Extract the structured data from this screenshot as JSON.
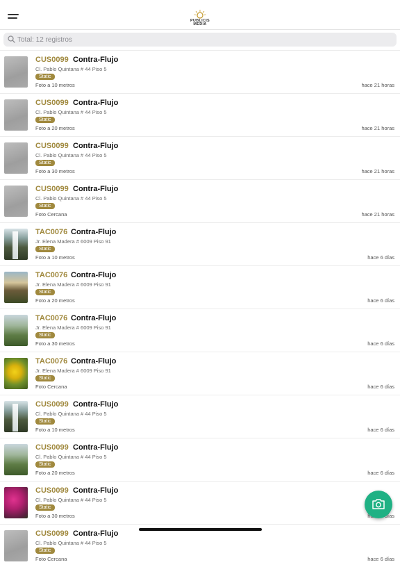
{
  "header": {
    "menu_icon": "hamburger-menu-icon",
    "logo_text_line1": "PUBLICIS",
    "logo_text_line2": "MEDIA"
  },
  "search": {
    "placeholder": "Total: 12 registros",
    "icon": "search-icon"
  },
  "items": [
    {
      "code": "CUS0099",
      "title": "Contra-Flujo",
      "address": "Cl. Pablo Quintana # 44 Piso 5",
      "badge": "Static",
      "photo": "Foto a 10 metros",
      "time": "hace 21 horas",
      "thumb": "gray"
    },
    {
      "code": "CUS0099",
      "title": "Contra-Flujo",
      "address": "Cl. Pablo Quintana # 44 Piso 5",
      "badge": "Static",
      "photo": "Foto a 20 metros",
      "time": "hace 21 horas",
      "thumb": "gray"
    },
    {
      "code": "CUS0099",
      "title": "Contra-Flujo",
      "address": "Cl. Pablo Quintana # 44 Piso 5",
      "badge": "Static",
      "photo": "Foto a 30 metros",
      "time": "hace 21 horas",
      "thumb": "gray"
    },
    {
      "code": "CUS0099",
      "title": "Contra-Flujo",
      "address": "Cl. Pablo Quintana # 44 Piso 5",
      "badge": "Static",
      "photo": "Foto Cercana",
      "time": "hace 21 horas",
      "thumb": "gray"
    },
    {
      "code": "TAC0076",
      "title": "Contra-Flujo",
      "address": "Jr. Elena  Madera # 6009 Piso 91",
      "badge": "Static",
      "photo": "Foto a 10 metros",
      "time": "hace 6 días",
      "thumb": "falls"
    },
    {
      "code": "TAC0076",
      "title": "Contra-Flujo",
      "address": "Jr. Elena  Madera # 6009 Piso 91",
      "badge": "Static",
      "photo": "Foto a 20 metros",
      "time": "hace 6 días",
      "thumb": "cliff"
    },
    {
      "code": "TAC0076",
      "title": "Contra-Flujo",
      "address": "Jr. Elena  Madera # 6009 Piso 91",
      "badge": "Static",
      "photo": "Foto a 30 metros",
      "time": "hace 6 días",
      "thumb": "hill"
    },
    {
      "code": "TAC0076",
      "title": "Contra-Flujo",
      "address": "Jr. Elena  Madera # 6009 Piso 91",
      "badge": "Static",
      "photo": "Foto Cercana",
      "time": "hace 6 días",
      "thumb": "flower"
    },
    {
      "code": "CUS0099",
      "title": "Contra-Flujo",
      "address": "Cl. Pablo Quintana # 44 Piso 5",
      "badge": "Static",
      "photo": "Foto a 10 metros",
      "time": "hace 6 días",
      "thumb": "falls"
    },
    {
      "code": "CUS0099",
      "title": "Contra-Flujo",
      "address": "Cl. Pablo Quintana # 44 Piso 5",
      "badge": "Static",
      "photo": "Foto a 20 metros",
      "time": "hace 6 días",
      "thumb": "hill"
    },
    {
      "code": "CUS0099",
      "title": "Contra-Flujo",
      "address": "Cl. Pablo Quintana # 44 Piso 5",
      "badge": "Static",
      "photo": "Foto a 30 metros",
      "time": "hace 6 días",
      "thumb": "pink"
    },
    {
      "code": "CUS0099",
      "title": "Contra-Flujo",
      "address": "Cl. Pablo Quintana # 44 Piso 5",
      "badge": "Static",
      "photo": "Foto Cercana",
      "time": "hace 6 días",
      "thumb": "gray"
    }
  ],
  "fab": {
    "icon": "camera-icon"
  },
  "colors": {
    "accent": "#a0893e",
    "fab": "#1fb184"
  }
}
